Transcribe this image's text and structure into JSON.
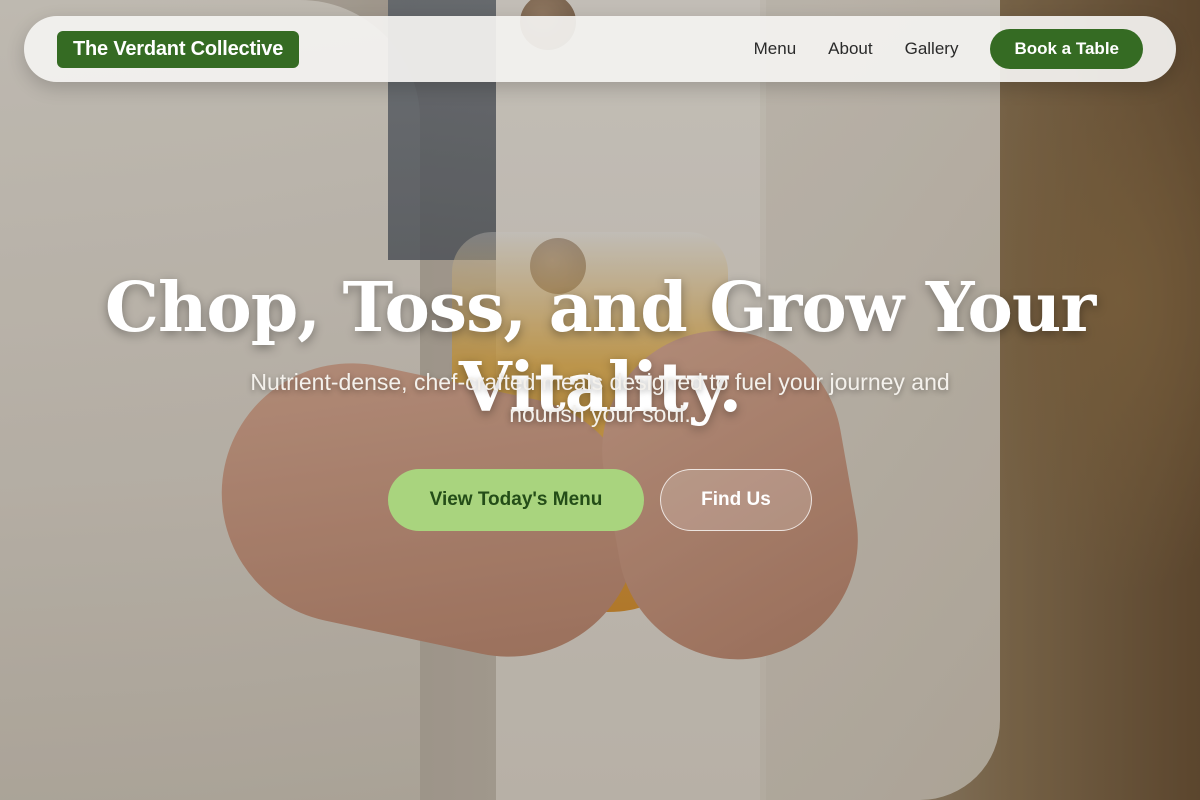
{
  "nav": {
    "brand": "The Verdant Collective",
    "links": [
      "Menu",
      "About",
      "Gallery"
    ],
    "cta_label": "Book a Table"
  },
  "hero": {
    "title": "Chop, Toss, and Grow Your Vitality.",
    "subtitle": "Nutrient-dense, chef-crafted meals designed to fuel your journey and nourish your soul.",
    "primary_cta": "View Today's Menu",
    "secondary_cta": "Find Us"
  },
  "colors": {
    "brand_green": "#356b23",
    "accent_light_green": "#a9d47e"
  }
}
